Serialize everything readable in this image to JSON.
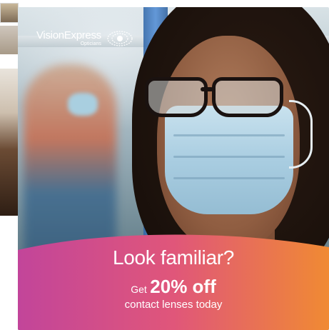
{
  "logo": {
    "brand": "VisionExpress",
    "sub": "Opticians",
    "icon": "eye-icon"
  },
  "ad": {
    "headline": "Look familiar?",
    "offer_pre": "Get",
    "offer_value": "20% off",
    "offer_sub": "contact lenses today"
  },
  "colors": {
    "wave_left": "#c2459a",
    "wave_mid": "#e0567a",
    "wave_right": "#f08a33"
  }
}
